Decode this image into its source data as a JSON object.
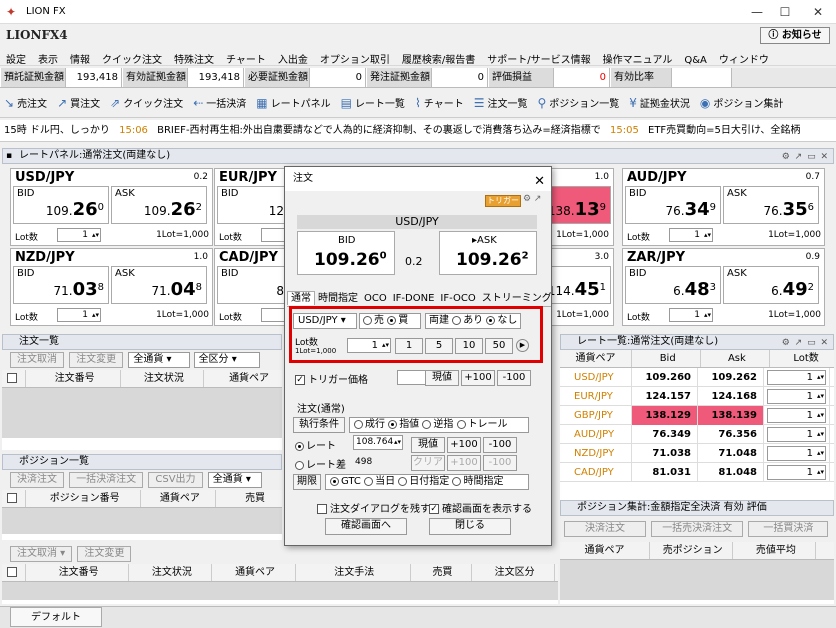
{
  "window": {
    "title": "LION FX"
  },
  "logo": "LIONFX4",
  "notice_button": "お知らせ",
  "menu": [
    "設定",
    "表示",
    "情報",
    "クイック注文",
    "特殊注文",
    "チャート",
    "入出金",
    "オプション取引",
    "履歴検索/報告書",
    "サポート/サービス情報",
    "操作マニュアル",
    "Q&A",
    "ウィンドウ"
  ],
  "margins": [
    {
      "label": "預託証拠金額",
      "value": "193,418"
    },
    {
      "label": "有効証拠金額",
      "value": "193,418"
    },
    {
      "label": "必要証拠金額",
      "value": "0"
    },
    {
      "label": "発注証拠金額",
      "value": "0"
    },
    {
      "label": "評価損益",
      "value": "0"
    },
    {
      "label": "有効比率",
      "value": ""
    }
  ],
  "toolbar": [
    {
      "icon": "sell-icon",
      "label": "売注文"
    },
    {
      "icon": "buy-icon",
      "label": "買注文"
    },
    {
      "icon": "quick-order-icon",
      "label": "クイック注文"
    },
    {
      "icon": "bulk-settle-icon",
      "label": "一括決済"
    },
    {
      "icon": "rate-panel-icon",
      "label": "レートパネル"
    },
    {
      "icon": "rate-list-icon",
      "label": "レート一覧"
    },
    {
      "icon": "chart-icon",
      "label": "チャート"
    },
    {
      "icon": "order-list-icon",
      "label": "注文一覧"
    },
    {
      "icon": "position-list-icon",
      "label": "ポジション一覧"
    },
    {
      "icon": "margin-status-icon",
      "label": "証拠金状況"
    },
    {
      "icon": "position-summary-icon",
      "label": "ポジション集計"
    }
  ],
  "ticker": {
    "prefix": "15時 ドル円、しっかり",
    "time1": "15:06",
    "text1": "BRIEF-西村再生相:外出自粛要請などで人為的に経済抑制、その裏返しで消費落ち込み=経済指標で",
    "time2": "15:05",
    "text2": "ETF売買動向=5日大引け、全銘柄"
  },
  "rate_panel": {
    "title": "レートパネル:通常注文(両建なし)",
    "cards": [
      {
        "pair": "USD/JPY",
        "spread": "0.2",
        "bid_label": "BID",
        "ask_label": "ASK",
        "bid_pre": "109.",
        "bid_big": "26",
        "bid_sup": "0",
        "ask_pre": "109.",
        "ask_big": "26",
        "ask_sup": "2",
        "lot_label": "Lot数",
        "lot": "1",
        "lot_unit": "1Lot=1,000"
      },
      {
        "pair": "EUR/JPY",
        "spread": "",
        "bid_label": "BID",
        "ask_label": "",
        "bid_pre": "124.",
        "bid_big": "1",
        "bid_sup": "",
        "ask_pre": "",
        "ask_big": "",
        "ask_sup": "",
        "lot_label": "Lot数",
        "lot": "1",
        "lot_unit": ""
      },
      {
        "pair": "AUD/JPY",
        "spread": "0.7",
        "bid_label": "BID",
        "ask_label": "ASK",
        "bid_pre": "76.",
        "bid_big": "34",
        "bid_sup": "9",
        "ask_pre": "76.",
        "ask_big": "35",
        "ask_sup": "6",
        "lot_label": "Lot数",
        "lot": "1",
        "lot_unit": "1Lot=1,000"
      },
      {
        "pair": "NZD/JPY",
        "spread": "1.0",
        "bid_label": "BID",
        "ask_label": "ASK",
        "bid_pre": "71.",
        "bid_big": "03",
        "bid_sup": "8",
        "ask_pre": "71.",
        "ask_big": "04",
        "ask_sup": "8",
        "lot_label": "Lot数",
        "lot": "1",
        "lot_unit": "1Lot=1,000"
      },
      {
        "pair": "CAD/JPY",
        "spread": "",
        "bid_label": "BID",
        "ask_label": "",
        "bid_pre": "81.",
        "bid_big": "0",
        "bid_sup": "",
        "ask_pre": "",
        "ask_big": "",
        "ask_sup": "",
        "lot_label": "Lot数",
        "lot": "1",
        "lot_unit": ""
      },
      {
        "pair": "ZAR/JPY",
        "spread": "0.9",
        "bid_label": "BID",
        "ask_label": "ASK",
        "bid_pre": "6.",
        "bid_big": "48",
        "bid_sup": "3",
        "ask_pre": "6.",
        "ask_big": "49",
        "ask_sup": "2",
        "lot_label": "Lot数",
        "lot": "1",
        "lot_unit": "1Lot=1,000"
      }
    ],
    "partial": {
      "gbp_spread": "1.0",
      "gbp_ask_pre": "138.",
      "gbp_ask_big": "13",
      "gbp_ask_sup": "9",
      "gbp_lot_unit": "1Lot=1,000",
      "cad_spread": "3.0",
      "cad_ask_pre": "114.",
      "cad_ask_big": "45",
      "cad_ask_sup": "1",
      "cad_lot_unit": "1Lot=1,000"
    }
  },
  "order_list": {
    "title": "注文一覧",
    "cancel": "注文取消",
    "change": "注文変更",
    "filter1": "全通貨",
    "filter2": "全区分",
    "cols": [
      "注文番号",
      "注文状況",
      "通貨ペア"
    ]
  },
  "position_list": {
    "title": "ポジション一覧",
    "settle": "決済注文",
    "bulk": "一括決済注文",
    "csv": "CSV出力",
    "filter": "全通貨",
    "cols": [
      "ポジション番号",
      "通貨ペア",
      "売買"
    ]
  },
  "bottom_orders": {
    "cancel": "注文取消",
    "change": "注文変更",
    "cols": [
      "注文番号",
      "注文状況",
      "通貨ペア",
      "注文手法",
      "売買",
      "注文区分"
    ]
  },
  "rate_list": {
    "title": "レート一覧:通常注文(両建なし)",
    "cols": [
      "通貨ペア",
      "Bid",
      "Ask",
      "Lot数"
    ],
    "rows": [
      {
        "pair": "USD/JPY",
        "bid": "109.260",
        "ask": "109.262",
        "lot": "1",
        "hl": false
      },
      {
        "pair": "EUR/JPY",
        "bid": "124.157",
        "ask": "124.168",
        "lot": "1",
        "hl": false
      },
      {
        "pair": "GBP/JPY",
        "bid": "138.129",
        "ask": "138.139",
        "lot": "1",
        "hl": true
      },
      {
        "pair": "AUD/JPY",
        "bid": "76.349",
        "ask": "76.356",
        "lot": "1",
        "hl": false
      },
      {
        "pair": "NZD/JPY",
        "bid": "71.038",
        "ask": "71.048",
        "lot": "1",
        "hl": false
      },
      {
        "pair": "CAD/JPY",
        "bid": "81.031",
        "ask": "81.048",
        "lot": "1",
        "hl": false
      }
    ]
  },
  "pos_summary": {
    "title": "ポジション集計:金額指定全決済 有効 評価",
    "settle": "決済注文",
    "bulk": "一括売決済注文",
    "bulk2": "一括買決済",
    "cols": [
      "通貨ペア",
      "売ポジション",
      "売値平均"
    ]
  },
  "status_tab": "デフォルト",
  "dialog": {
    "title": "注文",
    "trigger_badge": "トリガー",
    "pair": "USD/JPY",
    "bid_label": "BID",
    "bid_pre": "109.26",
    "bid_sup": "0",
    "spread": "0.2",
    "ask_label": "ASK",
    "ask_pre": "109.26",
    "ask_sup": "2",
    "tabs": [
      "通常",
      "時間指定",
      "OCO",
      "IF-DONE",
      "IF-OCO",
      "ストリーミング"
    ],
    "pair_select": "USD/JPY",
    "sell": "売",
    "buy": "買",
    "hedge_label": "両建",
    "hedge_on": "あり",
    "hedge_off": "なし",
    "lot_label": "Lot数",
    "lot_unit": "1Lot=1,000",
    "lot_value": "1",
    "lot_presets": [
      "1",
      "5",
      "10",
      "50"
    ],
    "trigger_label": "トリガー価格",
    "current": "現値",
    "plus100": "+100",
    "minus100": "-100",
    "section": "注文(通常)",
    "exec_label": "執行条件",
    "exec_market": "成行",
    "exec_limit": "指値",
    "exec_stop": "逆指",
    "exec_trail": "トレール",
    "rate_label": "レート",
    "rate_value": "108.764",
    "rate_diff_label": "レート差",
    "rate_diff_value": "498",
    "clear": "クリア",
    "period_label": "期限",
    "gtc": "GTC",
    "today": "当日",
    "date_spec": "日付指定",
    "time_spec": "時間指定",
    "keep_dialog": "注文ダイアログを残す",
    "show_confirm": "確認画面を表示する",
    "confirm_btn": "確認画面へ",
    "close_btn": "閉じる"
  }
}
